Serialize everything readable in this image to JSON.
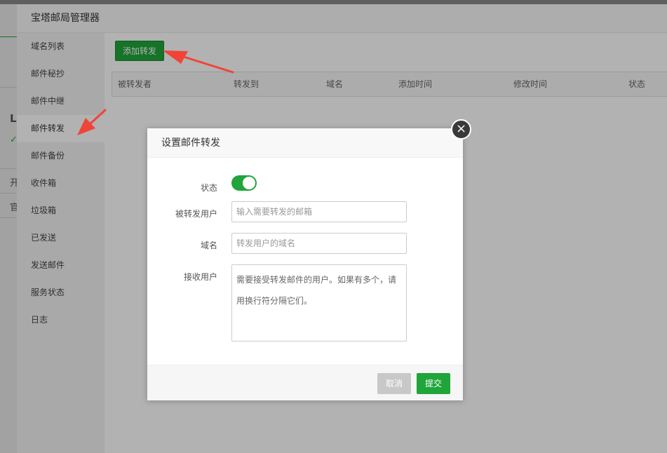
{
  "panel": {
    "title": "宝塔邮局管理器"
  },
  "sidebar": {
    "items": [
      {
        "label": "域名列表"
      },
      {
        "label": "邮件秘抄"
      },
      {
        "label": "邮件中继"
      },
      {
        "label": "邮件转发"
      },
      {
        "label": "邮件备份"
      },
      {
        "label": "收件箱"
      },
      {
        "label": "垃圾箱"
      },
      {
        "label": "已发送"
      },
      {
        "label": "发送邮件"
      },
      {
        "label": "服务状态"
      },
      {
        "label": "日志"
      }
    ],
    "active_index": 3
  },
  "content": {
    "add_button": "添加转发",
    "table": {
      "columns": [
        "被转发者",
        "转发到",
        "域名",
        "添加时间",
        "修改时间",
        "状态"
      ]
    }
  },
  "dialog": {
    "title": "设置邮件转发",
    "status_label": "状态",
    "status_on": true,
    "forwarded_user_label": "被转发用户",
    "forwarded_user_placeholder": "输入需要转发的邮箱",
    "domain_label": "域名",
    "domain_placeholder": "转发用户的域名",
    "receiver_label": "接收用户",
    "receiver_placeholder": "需要接受转发邮件的用户。如果有多个，请用换行符分隔它们。",
    "cancel_label": "取消",
    "submit_label": "提交"
  },
  "background": {
    "fragments": [
      "L",
      "✓",
      "开",
      "官"
    ]
  },
  "colors": {
    "accent": "#20a53a",
    "arrow": "#f04438"
  }
}
